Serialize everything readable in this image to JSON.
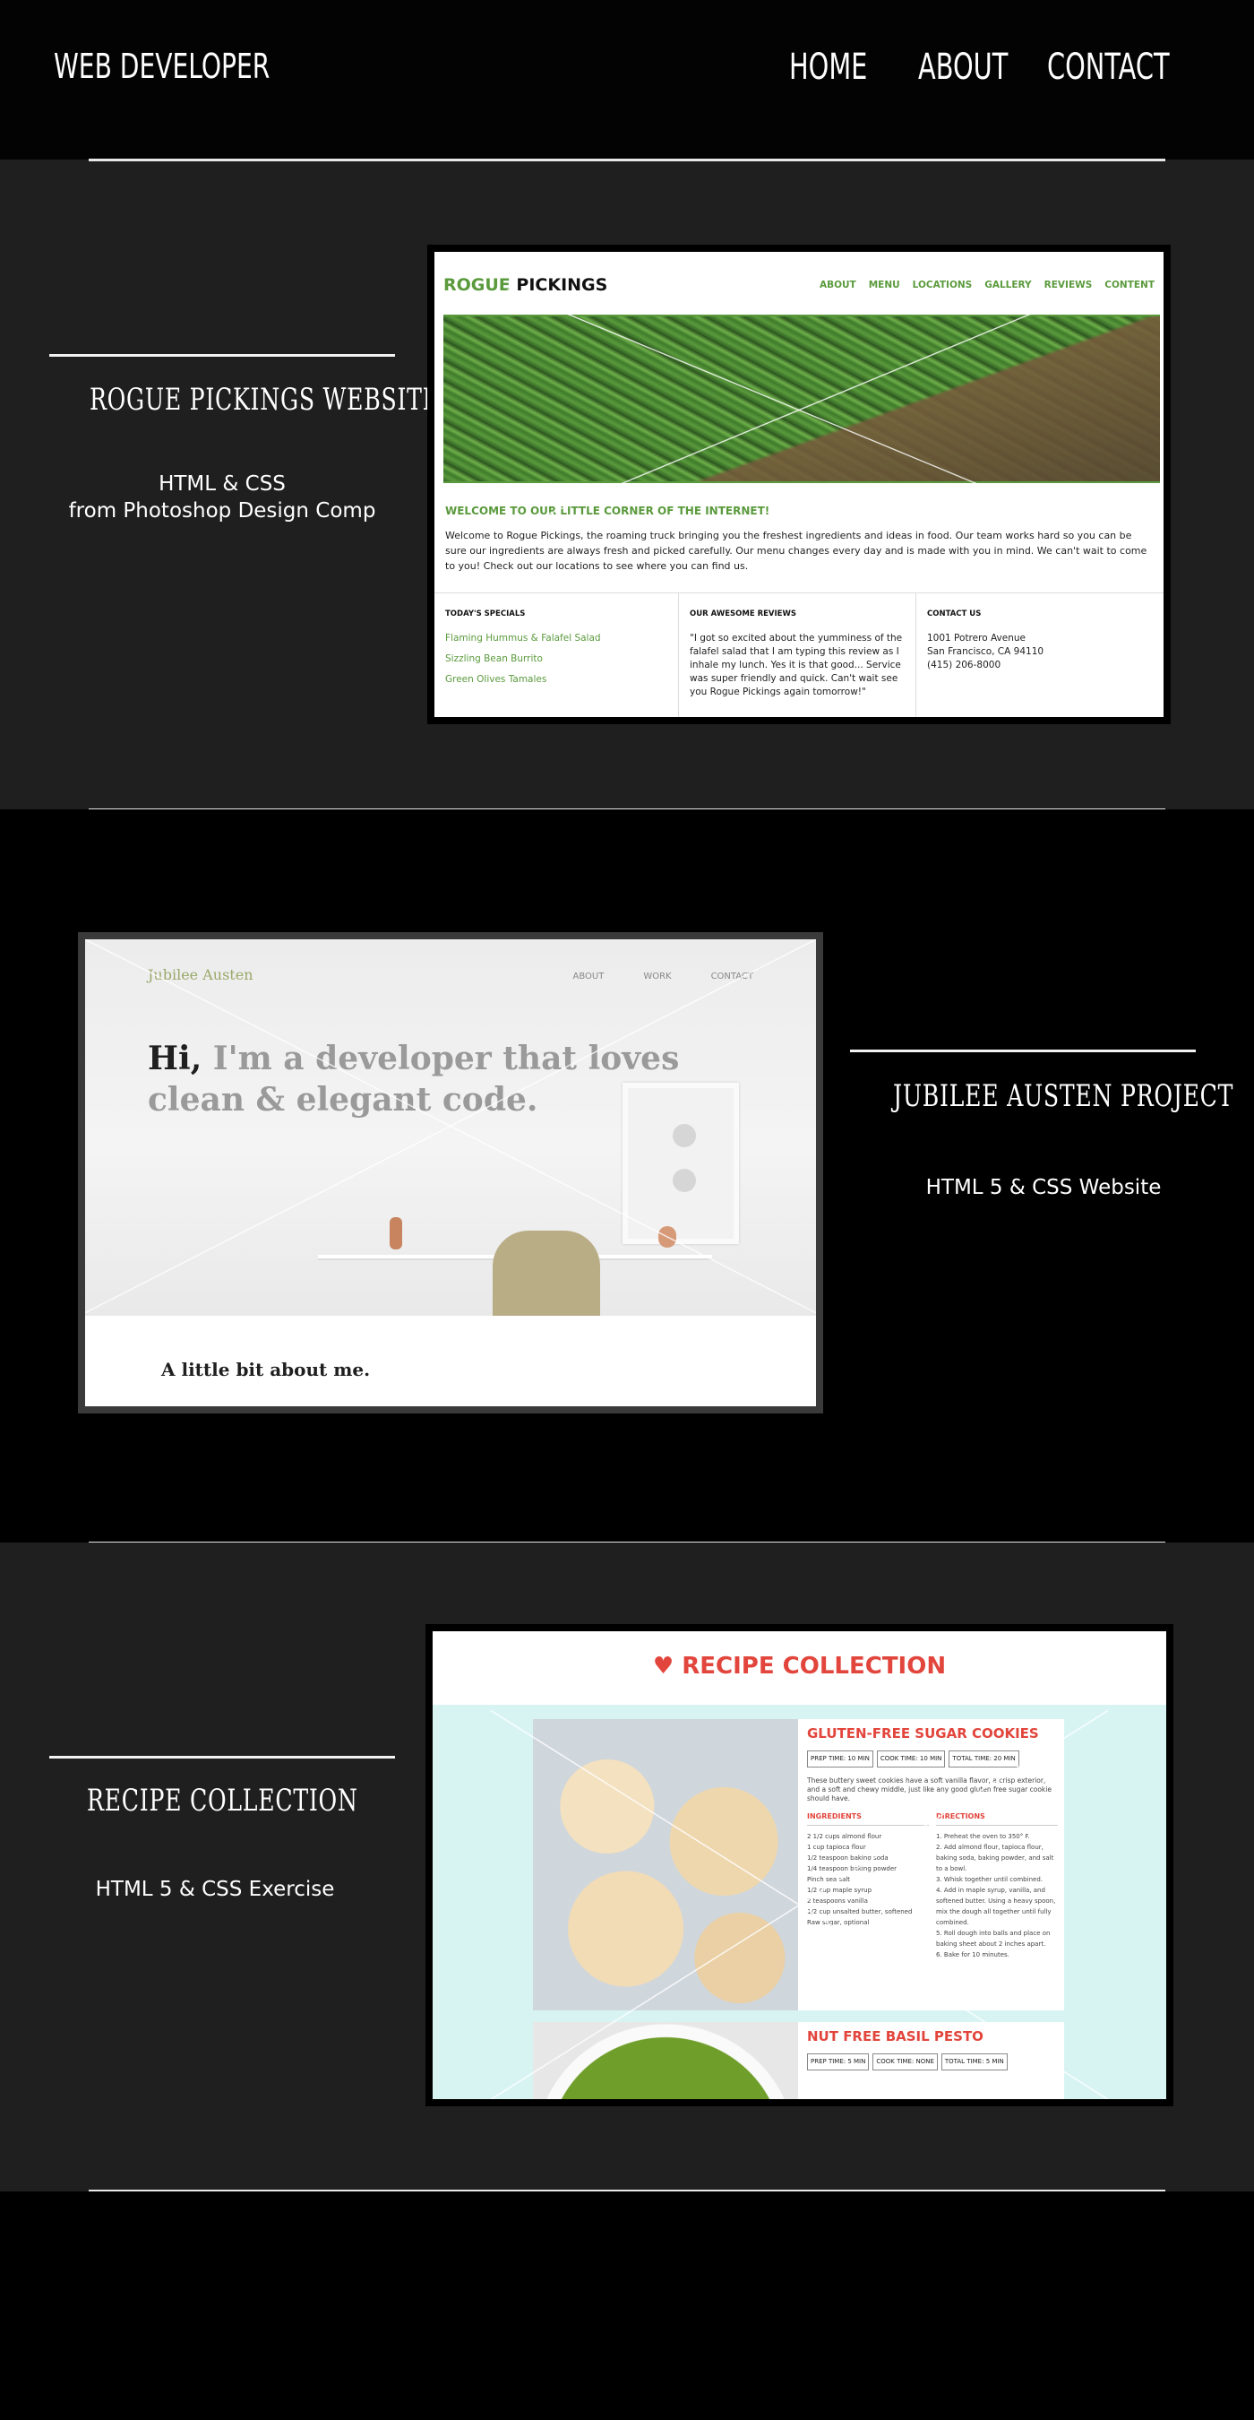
{
  "header": {
    "brand": "WEB DEVELOPER",
    "nav": [
      "HOME",
      "ABOUT",
      "CONTACT"
    ]
  },
  "projects": [
    {
      "title": "ROGUE PICKINGS WEBSITE",
      "desc_line1": "HTML & CSS",
      "desc_line2": "from Photoshop Design Comp",
      "preview": {
        "logo_a": "ROGUE",
        "logo_b": " PICKINGS",
        "nav": [
          "ABOUT",
          "MENU",
          "LOCATIONS",
          "GALLERY",
          "REVIEWS",
          "CONTENT"
        ],
        "welcome": "WELCOME TO OUR LITTLE CORNER OF THE INTERNET!",
        "body": "Welcome to Rogue Pickings, the roaming truck bringing you the freshest ingredients and ideas in food. Our team works hard so you can be sure our ingredients are always fresh and picked carefully. Our menu changes every day and is made with you in mind. We can't wait to come to you! Check out our locations to see where you can find us.",
        "col1_title": "TODAY'S SPECIALS",
        "specials": [
          "Flaming Hummus & Falafel Salad",
          "Sizzling Bean Burrito",
          "Green Olives Tamales"
        ],
        "col2_title": "OUR AWESOME REVIEWS",
        "review": "\"I got so excited about the yumminess of the falafel salad that I am typing this review as I inhale my lunch. Yes it is that good... Service was super friendly and quick. Can't wait see you Rogue Pickings again tomorrow!\"",
        "col3_title": "CONTACT US",
        "address": [
          "1001 Potrero Avenue",
          "San Francisco, CA 94110",
          "(415) 206-8000"
        ]
      }
    },
    {
      "title": "JUBILEE AUSTEN PROJECT",
      "desc_line1": "HTML 5 & CSS Website",
      "preview": {
        "logo": "Jubilee Austen",
        "nav": [
          "ABOUT",
          "WORK",
          "CONTACT"
        ],
        "hero_hi": "Hi,",
        "hero_rest": " I'm a developer that loves",
        "hero_line2": "clean & elegant code.",
        "about": "A little bit about me."
      }
    },
    {
      "title": "RECIPE COLLECTION",
      "desc_line1": "HTML 5 & CSS Exercise",
      "preview": {
        "heading": "♥ RECIPE COLLECTION",
        "recipe1": "GLUTEN-FREE SUGAR COOKIES",
        "r1_times": [
          "PREP TIME: 10 MIN",
          "COOK TIME: 10 MIN",
          "TOTAL TIME: 20 MIN"
        ],
        "r1_para": "These buttery sweet cookies have a soft vanilla flavor, a crisp exterior, and a soft and chewy middle, just like any good gluten free sugar cookie should have.",
        "ingredients_label": "INGREDIENTS",
        "directions_label": "DIRECTIONS",
        "ingredients": [
          "2 1/2 cups almond flour",
          "1 cup tapioca flour",
          "1/2 teaspoon baking soda",
          "1/4 teaspoon baking powder",
          "Pinch sea salt",
          "1/2 cup maple syrup",
          "2 teaspoons vanilla",
          "1/2 cup unsalted butter, softened",
          "Raw sugar, optional"
        ],
        "directions": [
          "1. Preheat the oven to 350° F.",
          "2. Add almond flour, tapioca flour, baking soda, baking powder, and salt to a bowl.",
          "3. Whisk together until combined.",
          "4. Add in maple syrup, vanilla, and softened butter. Using a heavy spoon, mix the dough all together until fully combined.",
          "5. Roll dough into balls and place on baking sheet about 2 inches apart.",
          "6. Bake for 10 minutes."
        ],
        "recipe2": "NUT FREE BASIL PESTO",
        "r2_times": [
          "PREP TIME: 5 MIN",
          "COOK TIME: NONE",
          "TOTAL TIME: 5 MIN"
        ]
      }
    }
  ]
}
